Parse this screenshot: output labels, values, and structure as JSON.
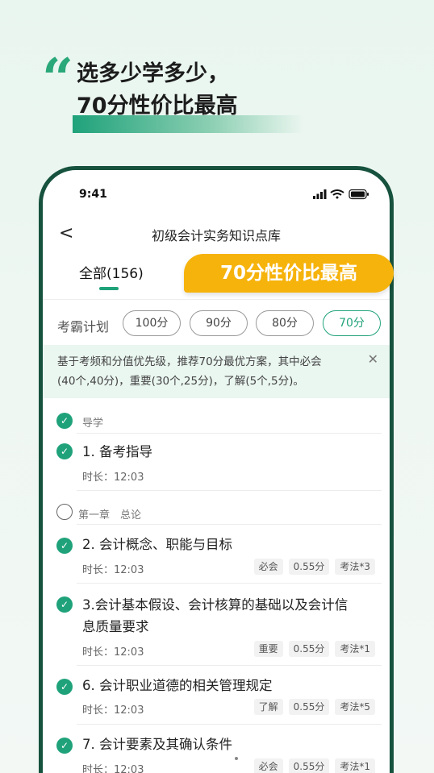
{
  "promo": {
    "quote_mark": "“",
    "line1": "选多少学多少，",
    "line2": "70分性价比最高"
  },
  "status_bar": {
    "time": "9:41"
  },
  "navbar": {
    "back_icon": "chevron-left-icon",
    "back_glyph": "<",
    "title": "初级会计实务知识点库"
  },
  "tabs": [
    {
      "label": "全部(156)",
      "active": true
    }
  ],
  "badge": {
    "label": "70分性价比最高",
    "color": "#f6b30c"
  },
  "plan": {
    "label": "考霸计划",
    "options": [
      "100分",
      "90分",
      "80分",
      "70分"
    ],
    "selected": "70分"
  },
  "tip": {
    "line1": "基于考频和分值优先级，推荐70分最优方案，其中必会",
    "line2": "(40个,40分)，重要(30个,25分)，了解(5个,5分)。",
    "close_glyph": "✕"
  },
  "sections": [
    {
      "title": "导学",
      "completed": true,
      "items": [
        {
          "title": "1. 备考指导",
          "duration": "时长：12:03",
          "completed": true,
          "tags": []
        }
      ]
    },
    {
      "title": "第一章　总论",
      "completed": false,
      "items": [
        {
          "title": "2. 会计概念、职能与目标",
          "duration": "时长：12:03",
          "completed": true,
          "tags": [
            "必会",
            "0.55分",
            "考法*3"
          ]
        },
        {
          "title_line1": "3.会计基本假设、会计核算的基础以及会计信",
          "title_line2": "息质量要求",
          "duration": "时长：12:03",
          "completed": true,
          "tags": [
            "重要",
            "0.55分",
            "考法*1"
          ]
        },
        {
          "title": "6. 会计职业道德的相关管理规定",
          "duration": "时长：12:03",
          "completed": true,
          "tags": [
            "了解",
            "0.55分",
            "考法*5"
          ]
        },
        {
          "title": "7. 会计要素及其确认条件",
          "duration": "时长：12:03",
          "completed": true,
          "tags": [
            "必会",
            "0.55分",
            "考法*1"
          ]
        }
      ]
    }
  ],
  "colors": {
    "accent": "#1fa27a",
    "frame": "#16523d",
    "badge": "#f6b30c"
  }
}
